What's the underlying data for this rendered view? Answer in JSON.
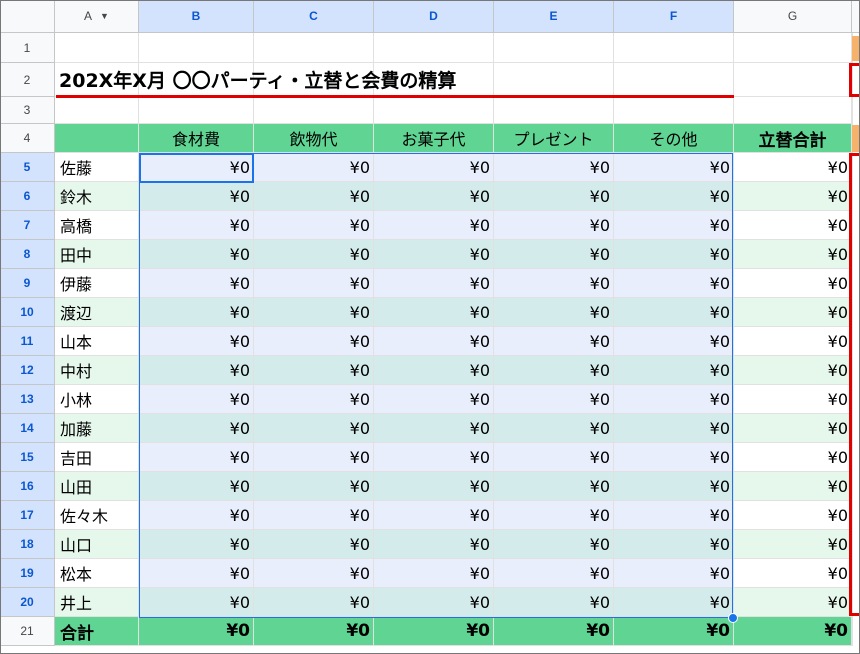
{
  "columns": [
    "A",
    "B",
    "C",
    "D",
    "E",
    "F",
    "G"
  ],
  "rows": [
    "1",
    "2",
    "3",
    "4",
    "5",
    "6",
    "7",
    "8",
    "9",
    "10",
    "11",
    "12",
    "13",
    "14",
    "15",
    "16",
    "17",
    "18",
    "19",
    "20",
    "21"
  ],
  "title": "202X年X月 〇〇パーティ・立替と会費の精算",
  "headers": [
    "食材費",
    "飲物代",
    "お菓子代",
    "プレゼント",
    "その他",
    "立替合計"
  ],
  "names": [
    "佐藤",
    "鈴木",
    "高橋",
    "田中",
    "伊藤",
    "渡辺",
    "山本",
    "中村",
    "小林",
    "加藤",
    "吉田",
    "山田",
    "佐々木",
    "山口",
    "松本",
    "井上"
  ],
  "cell_value": "¥0",
  "total_label": "合計",
  "icons": {
    "filter": "filter-dropdown-icon",
    "fill_handle": "fill-handle"
  },
  "colors": {
    "header_green": "#5fd493",
    "stripe_green": "#e6f7ec",
    "selection_blue": "#1a73e8",
    "title_underline": "#e00000"
  }
}
